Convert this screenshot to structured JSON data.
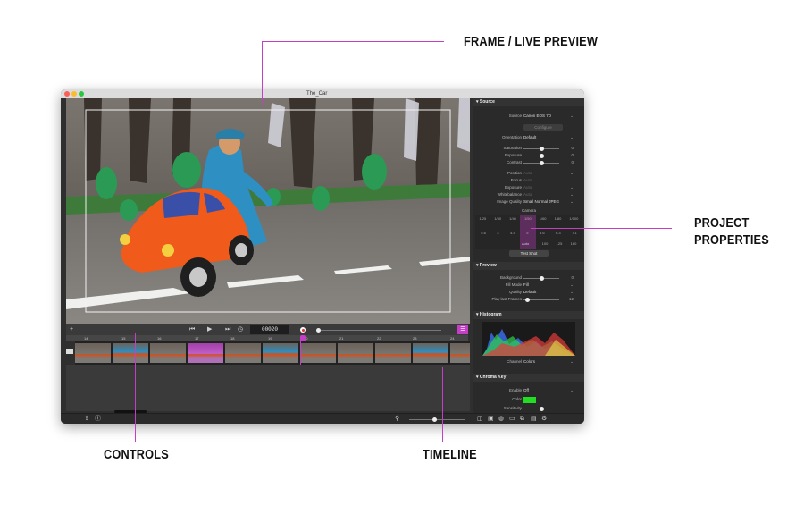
{
  "callouts": {
    "frame_preview": "FRAME / LIVE PREVIEW",
    "project_properties": "PROJECT\nPROPERTIES",
    "controls": "CONTROLS",
    "timeline": "TIMELINE"
  },
  "window": {
    "title": "The_Car"
  },
  "colors": {
    "accent": "#c53fc6",
    "chroma_color": "#22dd22"
  },
  "panel": {
    "source": {
      "header": "Source",
      "source_label": "Source",
      "source_value": "Canon EOS 7D",
      "configure_button": "Configure",
      "orientation_label": "Orientation",
      "orientation_value": "Default",
      "saturation_label": "Saturation",
      "saturation_num": "0",
      "exposure_label": "Exposure",
      "exposure_num": "0",
      "contrast_label": "Contrast",
      "contrast_num": "0",
      "position_label": "Position",
      "position_value": "Auto",
      "focus_label": "Focus",
      "focus_value": "Auto",
      "exposure2_label": "Exposure",
      "exposure2_value": "Auto",
      "whitebalance_label": "Whitebalance",
      "whitebalance_value": "Auto",
      "image_quality_label": "Image Quality",
      "image_quality_value": "Small Normal JPEG",
      "camera_header": "Camera",
      "shutter_values": [
        "1/25",
        "1/30",
        "1/40",
        "1/50",
        "1/60",
        "1/80",
        "1/100"
      ],
      "aperture_values": [
        "5.6",
        "4",
        "4.5",
        "5",
        "5.6",
        "6.3",
        "7.1"
      ],
      "mode_label": "Auto",
      "iso_values": [
        "100",
        "125",
        "160"
      ],
      "test_shot_button": "Test Shot"
    },
    "preview": {
      "header": "Preview",
      "background_label": "Background",
      "background_num": "0",
      "fill_mode_label": "Fill Mode",
      "fill_mode_value": "Fill",
      "quality_label": "Quality",
      "quality_value": "Default",
      "play_last_label": "Play last Frames",
      "play_last_num": "12"
    },
    "histogram": {
      "header": "Histogram",
      "channel_label": "Channel",
      "channel_value": "Colors"
    },
    "chroma": {
      "header": "Chroma Key",
      "enable_label": "Enable",
      "enable_value": "Off",
      "color_label": "Color",
      "sensitivity_label": "Sensitivity"
    }
  },
  "controls": {
    "frame_counter": "00020",
    "ruler_ticks": [
      "14",
      "15",
      "16",
      "17",
      "18",
      "19",
      "20",
      "21",
      "22",
      "23",
      "24"
    ]
  }
}
